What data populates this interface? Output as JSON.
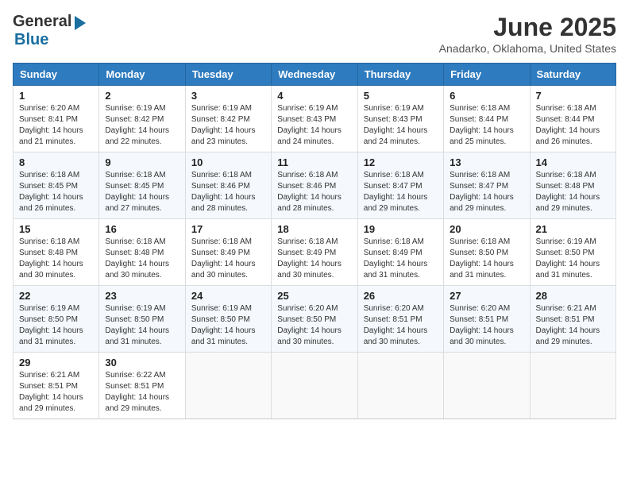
{
  "header": {
    "logo_general": "General",
    "logo_blue": "Blue",
    "title": "June 2025",
    "subtitle": "Anadarko, Oklahoma, United States"
  },
  "weekdays": [
    "Sunday",
    "Monday",
    "Tuesday",
    "Wednesday",
    "Thursday",
    "Friday",
    "Saturday"
  ],
  "weeks": [
    [
      {
        "day": "1",
        "sunrise": "6:20 AM",
        "sunset": "8:41 PM",
        "daylight": "14 hours and 21 minutes."
      },
      {
        "day": "2",
        "sunrise": "6:19 AM",
        "sunset": "8:42 PM",
        "daylight": "14 hours and 22 minutes."
      },
      {
        "day": "3",
        "sunrise": "6:19 AM",
        "sunset": "8:42 PM",
        "daylight": "14 hours and 23 minutes."
      },
      {
        "day": "4",
        "sunrise": "6:19 AM",
        "sunset": "8:43 PM",
        "daylight": "14 hours and 24 minutes."
      },
      {
        "day": "5",
        "sunrise": "6:19 AM",
        "sunset": "8:43 PM",
        "daylight": "14 hours and 24 minutes."
      },
      {
        "day": "6",
        "sunrise": "6:18 AM",
        "sunset": "8:44 PM",
        "daylight": "14 hours and 25 minutes."
      },
      {
        "day": "7",
        "sunrise": "6:18 AM",
        "sunset": "8:44 PM",
        "daylight": "14 hours and 26 minutes."
      }
    ],
    [
      {
        "day": "8",
        "sunrise": "6:18 AM",
        "sunset": "8:45 PM",
        "daylight": "14 hours and 26 minutes."
      },
      {
        "day": "9",
        "sunrise": "6:18 AM",
        "sunset": "8:45 PM",
        "daylight": "14 hours and 27 minutes."
      },
      {
        "day": "10",
        "sunrise": "6:18 AM",
        "sunset": "8:46 PM",
        "daylight": "14 hours and 28 minutes."
      },
      {
        "day": "11",
        "sunrise": "6:18 AM",
        "sunset": "8:46 PM",
        "daylight": "14 hours and 28 minutes."
      },
      {
        "day": "12",
        "sunrise": "6:18 AM",
        "sunset": "8:47 PM",
        "daylight": "14 hours and 29 minutes."
      },
      {
        "day": "13",
        "sunrise": "6:18 AM",
        "sunset": "8:47 PM",
        "daylight": "14 hours and 29 minutes."
      },
      {
        "day": "14",
        "sunrise": "6:18 AM",
        "sunset": "8:48 PM",
        "daylight": "14 hours and 29 minutes."
      }
    ],
    [
      {
        "day": "15",
        "sunrise": "6:18 AM",
        "sunset": "8:48 PM",
        "daylight": "14 hours and 30 minutes."
      },
      {
        "day": "16",
        "sunrise": "6:18 AM",
        "sunset": "8:48 PM",
        "daylight": "14 hours and 30 minutes."
      },
      {
        "day": "17",
        "sunrise": "6:18 AM",
        "sunset": "8:49 PM",
        "daylight": "14 hours and 30 minutes."
      },
      {
        "day": "18",
        "sunrise": "6:18 AM",
        "sunset": "8:49 PM",
        "daylight": "14 hours and 30 minutes."
      },
      {
        "day": "19",
        "sunrise": "6:18 AM",
        "sunset": "8:49 PM",
        "daylight": "14 hours and 31 minutes."
      },
      {
        "day": "20",
        "sunrise": "6:18 AM",
        "sunset": "8:50 PM",
        "daylight": "14 hours and 31 minutes."
      },
      {
        "day": "21",
        "sunrise": "6:19 AM",
        "sunset": "8:50 PM",
        "daylight": "14 hours and 31 minutes."
      }
    ],
    [
      {
        "day": "22",
        "sunrise": "6:19 AM",
        "sunset": "8:50 PM",
        "daylight": "14 hours and 31 minutes."
      },
      {
        "day": "23",
        "sunrise": "6:19 AM",
        "sunset": "8:50 PM",
        "daylight": "14 hours and 31 minutes."
      },
      {
        "day": "24",
        "sunrise": "6:19 AM",
        "sunset": "8:50 PM",
        "daylight": "14 hours and 31 minutes."
      },
      {
        "day": "25",
        "sunrise": "6:20 AM",
        "sunset": "8:50 PM",
        "daylight": "14 hours and 30 minutes."
      },
      {
        "day": "26",
        "sunrise": "6:20 AM",
        "sunset": "8:51 PM",
        "daylight": "14 hours and 30 minutes."
      },
      {
        "day": "27",
        "sunrise": "6:20 AM",
        "sunset": "8:51 PM",
        "daylight": "14 hours and 30 minutes."
      },
      {
        "day": "28",
        "sunrise": "6:21 AM",
        "sunset": "8:51 PM",
        "daylight": "14 hours and 29 minutes."
      }
    ],
    [
      {
        "day": "29",
        "sunrise": "6:21 AM",
        "sunset": "8:51 PM",
        "daylight": "14 hours and 29 minutes."
      },
      {
        "day": "30",
        "sunrise": "6:22 AM",
        "sunset": "8:51 PM",
        "daylight": "14 hours and 29 minutes."
      },
      null,
      null,
      null,
      null,
      null
    ]
  ]
}
